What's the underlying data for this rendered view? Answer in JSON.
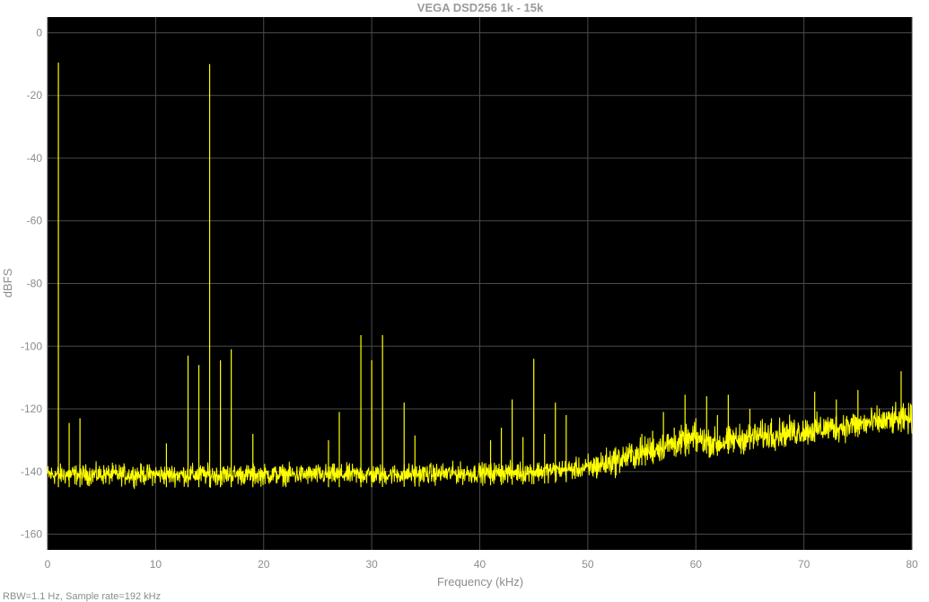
{
  "chart_data": {
    "type": "line",
    "title": "VEGA DSD256 1k -  15k",
    "xlabel": "Frequency (kHz)",
    "ylabel": "dBFS",
    "footer": "RBW=1.1 Hz, Sample rate=192 kHz",
    "xlim": [
      0,
      80
    ],
    "ylim": [
      -165,
      5
    ],
    "xticks": [
      0,
      10,
      20,
      30,
      40,
      50,
      60,
      70,
      80
    ],
    "yticks": [
      0,
      -20,
      -40,
      -60,
      -80,
      -100,
      -120,
      -140,
      -160
    ],
    "grid": true,
    "colors": {
      "background": "#000000",
      "grid": "#4a4a4a",
      "trace": "#ffff00",
      "axis_text": "#8c8c8c"
    },
    "noise_floor": {
      "x": [
        0,
        10,
        20,
        30,
        40,
        45,
        50,
        52,
        55,
        58,
        60,
        62,
        65,
        70,
        75,
        80
      ],
      "y": [
        -141,
        -141,
        -141,
        -141,
        -140.5,
        -140,
        -139,
        -137,
        -134,
        -131,
        -129.5,
        -131,
        -129,
        -127,
        -125,
        -123
      ]
    },
    "peaks": {
      "x": [
        1,
        2,
        3,
        11,
        13,
        14,
        15,
        16,
        17,
        19,
        26,
        27,
        29,
        30,
        31,
        33,
        34,
        41,
        42,
        43,
        44,
        45,
        46,
        47,
        48,
        55,
        56,
        57,
        58,
        59,
        60,
        61,
        62,
        63,
        65,
        67,
        71,
        73,
        75,
        79
      ],
      "y": [
        -9.5,
        -124.5,
        -123,
        -131,
        -103,
        -106,
        -10,
        -104.5,
        -101,
        -128,
        -130,
        -121,
        -96.5,
        -104.5,
        -96.5,
        -118,
        -128.5,
        -130,
        -126,
        -117,
        -129,
        -104,
        -128,
        -118,
        -122,
        -128,
        -127,
        -121,
        -126,
        -115.5,
        -123,
        -116,
        -122,
        -115.5,
        -120,
        -123,
        -114.5,
        -117,
        -114,
        -108
      ]
    }
  }
}
